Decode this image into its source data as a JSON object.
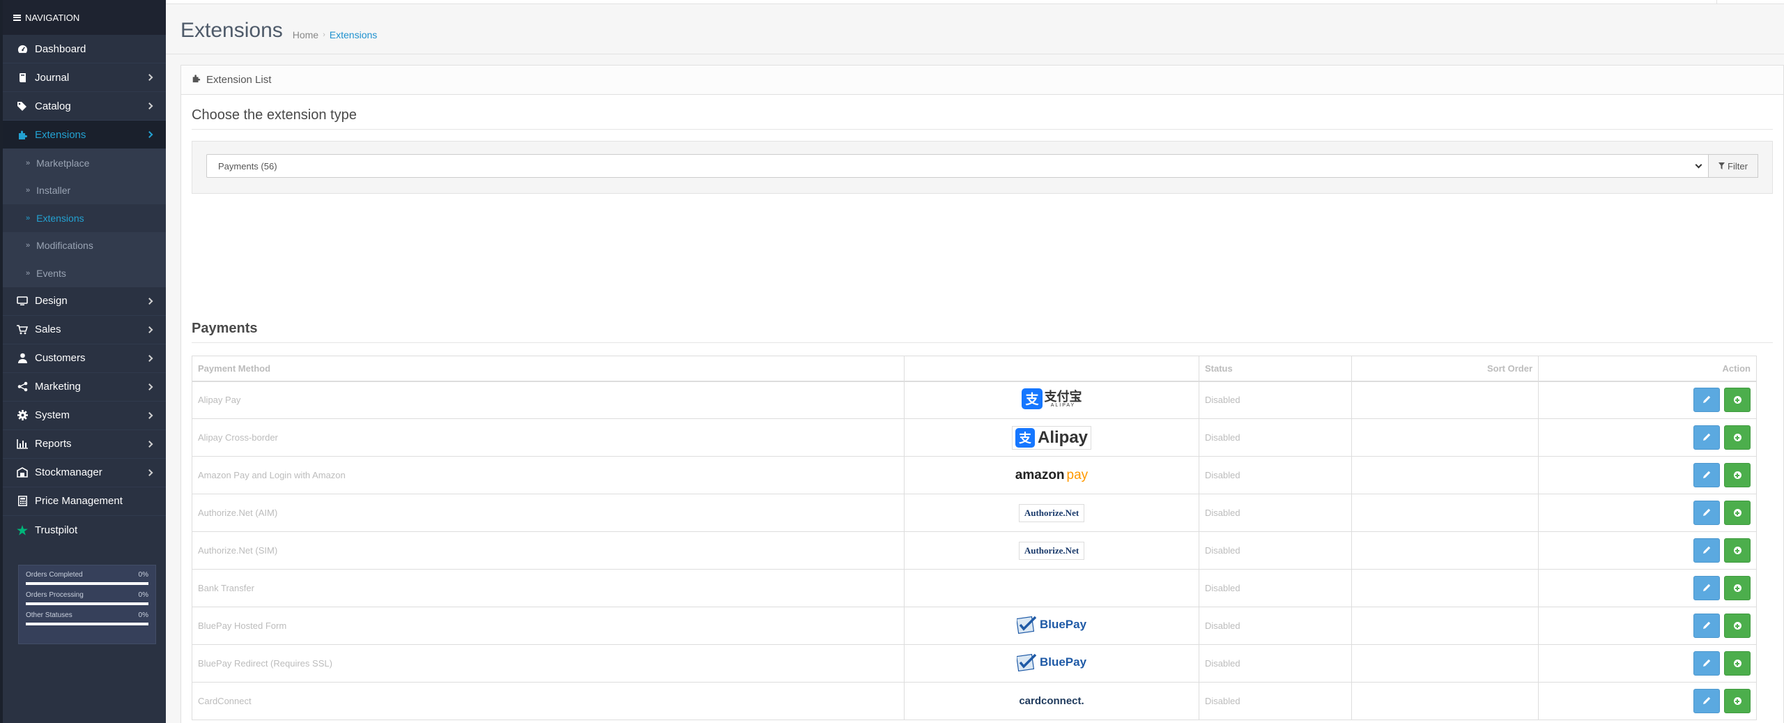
{
  "sidebar": {
    "header": "NAVIGATION",
    "items": [
      {
        "label": "Dashboard",
        "icon": "dashboard-icon"
      },
      {
        "label": "Journal",
        "icon": "journal-icon"
      },
      {
        "label": "Catalog",
        "icon": "tags-icon"
      },
      {
        "label": "Extensions",
        "icon": "puzzle-icon"
      },
      {
        "label": "Design",
        "icon": "monitor-icon"
      },
      {
        "label": "Sales",
        "icon": "cart-icon"
      },
      {
        "label": "Customers",
        "icon": "user-icon"
      },
      {
        "label": "Marketing",
        "icon": "share-icon"
      },
      {
        "label": "System",
        "icon": "gear-icon"
      },
      {
        "label": "Reports",
        "icon": "bar-chart-icon"
      },
      {
        "label": "Stockmanager",
        "icon": "warehouse-icon"
      },
      {
        "label": "Price Management",
        "icon": "calculator-icon"
      },
      {
        "label": "Trustpilot",
        "icon": "star-icon"
      }
    ],
    "extensions_sub": [
      "Marketplace",
      "Installer",
      "Extensions",
      "Modifications",
      "Events"
    ],
    "stats": [
      {
        "label": "Orders Completed",
        "value": "0%"
      },
      {
        "label": "Orders Processing",
        "value": "0%"
      },
      {
        "label": "Other Statuses",
        "value": "0%"
      }
    ]
  },
  "header": {
    "title": "Extensions",
    "breadcrumb_home": "Home",
    "breadcrumb_sep": "›",
    "breadcrumb_current": "Extensions"
  },
  "panel": {
    "heading": "Extension List",
    "choose_title": "Choose the extension type",
    "select_value": "Payments (56)",
    "filter_label": "Filter",
    "payments_title": "Payments"
  },
  "table": {
    "headers": [
      "Payment Method",
      "",
      "Status",
      "Sort Order",
      "Action"
    ],
    "rows": [
      {
        "name": "Alipay Pay",
        "status": "Disabled",
        "sort": "",
        "logo": "alipay-cn"
      },
      {
        "name": "Alipay Cross-border",
        "status": "Disabled",
        "sort": "",
        "logo": "alipay"
      },
      {
        "name": "Amazon Pay and Login with Amazon",
        "status": "Disabled",
        "sort": "",
        "logo": "amazon"
      },
      {
        "name": "Authorize.Net (AIM)",
        "status": "Disabled",
        "sort": "",
        "logo": "authorize"
      },
      {
        "name": "Authorize.Net (SIM)",
        "status": "Disabled",
        "sort": "",
        "logo": "authorize"
      },
      {
        "name": "Bank Transfer",
        "status": "Disabled",
        "sort": "",
        "logo": ""
      },
      {
        "name": "BluePay Hosted Form",
        "status": "Disabled",
        "sort": "",
        "logo": "bluepay"
      },
      {
        "name": "BluePay Redirect (Requires SSL)",
        "status": "Disabled",
        "sort": "",
        "logo": "bluepay"
      },
      {
        "name": "CardConnect",
        "status": "Disabled",
        "sort": "",
        "logo": "cardconnect"
      }
    ],
    "logo_text": {
      "alipay_cn": "支付宝",
      "alipay_cn_sub": "ALIPAY",
      "alipay": "Alipay",
      "amazon_a": "amazon",
      "amazon_b": "pay",
      "authorize": "Authorize.Net",
      "bluepay": "BluePay",
      "cardconnect": "cardconnect."
    }
  },
  "colors": {
    "sidebar_bg": "#2a3242",
    "accent": "#23a1d1",
    "edit_button": "#5ba9e0",
    "install_button": "#4cae4c"
  }
}
